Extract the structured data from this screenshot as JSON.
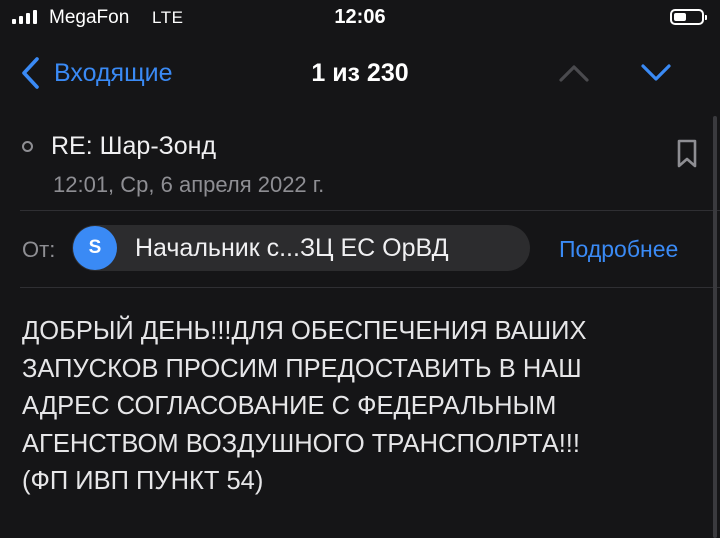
{
  "status_bar": {
    "carrier": "MegaFon",
    "network": "LTE",
    "time": "12:06"
  },
  "nav": {
    "back_label": "Входящие",
    "counter": "1 из 230",
    "icons": [
      "chevron-left-icon",
      "chevron-up-icon",
      "chevron-down-icon"
    ]
  },
  "message": {
    "subject": "RE: Шар-Зонд",
    "date": "12:01, Ср, 6 апреля 2022 г.",
    "from_label": "От:",
    "sender_initial": "S",
    "sender_name": "Начальник с...ЗЦ ЕС ОрВД",
    "details_link": "Подробнее",
    "body_lines": [
      "ДОБРЫЙ ДЕНЬ!!!ДЛЯ ОБЕСПЕЧЕНИЯ ВАШИХ",
      "ЗАПУСКОВ ПРОСИМ ПРЕДОСТАВИТЬ В НАШ",
      "АДРЕС СОГЛАСОВАНИЕ С ФЕДЕРАЛЬНЫМ",
      "АГЕНСТВОМ ВОЗДУШНОГО ТРАНСПОЛРТА!!!",
      "(ФП ИВП ПУНКТ 54)"
    ]
  },
  "colors": {
    "background": "#151517",
    "accent": "#3a8af5",
    "secondary_text": "#8e8e93",
    "chip": "#2c2c2e"
  }
}
